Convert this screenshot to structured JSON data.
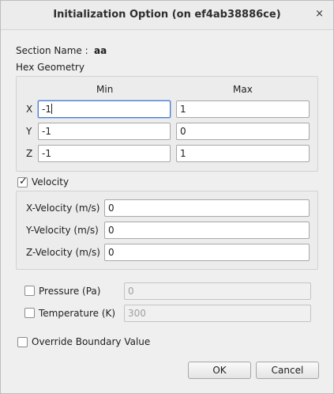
{
  "window": {
    "title": "Initialization Option (on ef4ab38886ce)",
    "close_glyph": "×",
    "close_icon": "close-icon"
  },
  "section": {
    "label": "Section Name :",
    "value": "aa"
  },
  "hex": {
    "heading": "Hex Geometry",
    "min_header": "Min",
    "max_header": "Max",
    "rows": [
      {
        "axis": "X",
        "min": "-1",
        "max": "1"
      },
      {
        "axis": "Y",
        "min": "-1",
        "max": "0"
      },
      {
        "axis": "Z",
        "min": "-1",
        "max": "1"
      }
    ]
  },
  "velocity": {
    "label": "Velocity",
    "checked": true,
    "check_glyph": "✓",
    "fields": [
      {
        "label": "X-Velocity (m/s)",
        "value": "0"
      },
      {
        "label": "Y-Velocity (m/s)",
        "value": "0"
      },
      {
        "label": "Z-Velocity (m/s)",
        "value": "0"
      }
    ]
  },
  "pressure": {
    "label": "Pressure (Pa)",
    "checked": false,
    "value": "0"
  },
  "temperature": {
    "label": "Temperature (K)",
    "checked": false,
    "value": "300"
  },
  "override": {
    "label": "Override Boundary Value",
    "checked": false
  },
  "buttons": {
    "ok": "OK",
    "cancel": "Cancel"
  }
}
